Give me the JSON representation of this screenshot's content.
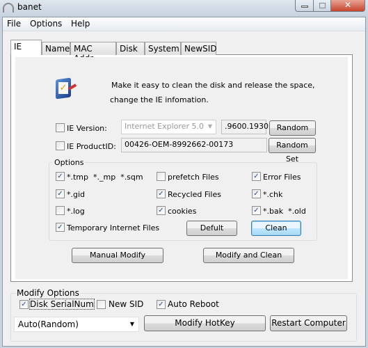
{
  "window": {
    "title": "banet"
  },
  "menu": [
    "File",
    "Options",
    "Help"
  ],
  "tabs": [
    "IE",
    "Name",
    "MAC Addr",
    "Disk",
    "System",
    "NewSID"
  ],
  "ie": {
    "description_line1": "Make it easy to clean the disk and release the space,",
    "description_line2": "change the IE infomation.",
    "ie_version": {
      "label": "IE Version:",
      "checked": false,
      "value": "Internet Explorer 5.0",
      "suffix": ".9600.1930",
      "button": "Random Set"
    },
    "ie_productid": {
      "label": "IE ProductID:",
      "checked": false,
      "value": "00426-OEM-8992662-00173",
      "button": "Random Set"
    },
    "options": {
      "title": "Options",
      "items": [
        {
          "label": "*.tmp  *._mp  *.sqm",
          "checked": true
        },
        {
          "label": "prefetch Files",
          "checked": false
        },
        {
          "label": "Error Files",
          "checked": true
        },
        {
          "label": "*.gid",
          "checked": true
        },
        {
          "label": "Recycled Files",
          "checked": true
        },
        {
          "label": "*.chk",
          "checked": true
        },
        {
          "label": "*.log",
          "checked": false
        },
        {
          "label": "cookies",
          "checked": true
        },
        {
          "label": "*.bak  *.old",
          "checked": true
        },
        {
          "label": "Temporary Internet Files",
          "checked": true
        }
      ],
      "default_button": "Defult",
      "clean_button": "Clean"
    },
    "manual_modify_button": "Manual Modify",
    "modify_clean_button": "Modify and Clean"
  },
  "modify_options": {
    "title": "Modify Options",
    "disk_serial": {
      "label": "Disk SerialNum",
      "checked": true
    },
    "new_sid": {
      "label": "New SID",
      "checked": false
    },
    "auto_reboot": {
      "label": "Auto Reboot",
      "checked": true
    },
    "mode_select": "Auto(Random)",
    "hotkey_button": "Modify HotKey",
    "restart_button": "Restart Computer"
  },
  "check_glyph": "✓"
}
